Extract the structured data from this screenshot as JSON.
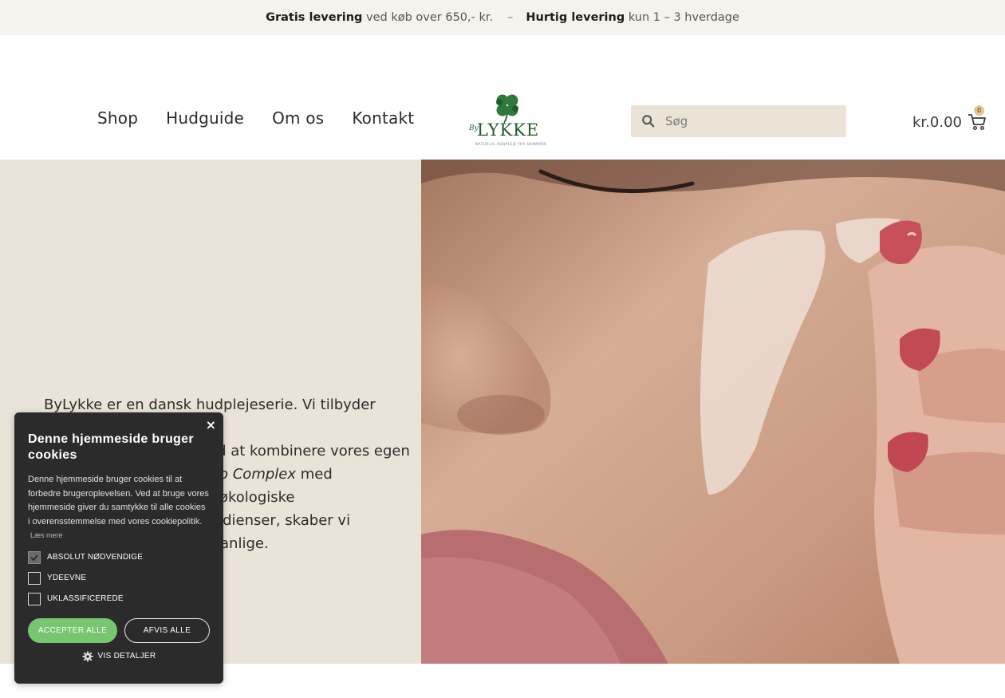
{
  "topbar": {
    "free_bold": "Gratis levering",
    "free_text": "ved køb over 650,- kr.",
    "separator": "–",
    "fast_bold": "Hurtig levering",
    "fast_text": "kun 1 – 3 hverdage"
  },
  "nav": {
    "items": [
      {
        "label": "Shop"
      },
      {
        "label": "Hudguide"
      },
      {
        "label": "Om os"
      },
      {
        "label": "Kontakt"
      }
    ]
  },
  "logo": {
    "by": "By",
    "name": "LYKKE",
    "tagline": "NATURLIG HUDPLEJE FRA DANMARK",
    "color": "#1f5c2e"
  },
  "search": {
    "placeholder": "Søg",
    "icon": "search-icon"
  },
  "cart": {
    "amount": "kr.0.00",
    "count": "0",
    "icon": "cart-icon"
  },
  "hero": {
    "line1": "ByLykke er en dansk hudplejeserie. Vi tilbyder unikke",
    "line2": "ed at kombinere vores egen",
    "line3_em": "o Complex",
    "line3_rest": " med økologiske",
    "line4": "edienser, skaber vi",
    "line5": "anlige.",
    "bg_color": "#eae3d7"
  },
  "cookie": {
    "close": "×",
    "title": "Denne hjemmeside bruger cookies",
    "body": "Denne hjemmeside bruger cookies til at forbedre brugeroplevelsen. Ved at bruge vores hjemmeside giver du samtykke til alle cookies i overensstemmelse med vores cookiepolitik.",
    "read_more": "Læs mere",
    "options": [
      {
        "label": "ABSOLUT NØDVENDIGE",
        "checked": true
      },
      {
        "label": "YDEEVNE",
        "checked": false
      },
      {
        "label": "UKLASSIFICEREDE",
        "checked": false
      }
    ],
    "accept": "ACCEPTER ALLE",
    "reject": "AFVIS ALLE",
    "details": "VIS DETALJER",
    "accent": "#78c66f"
  }
}
